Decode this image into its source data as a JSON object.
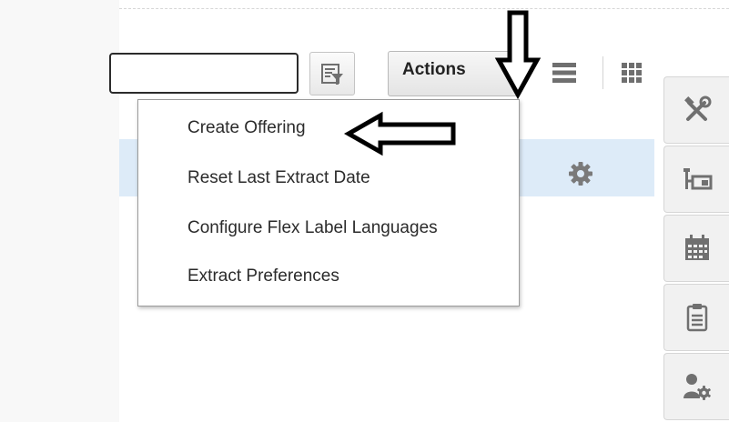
{
  "search": {
    "value": "",
    "placeholder": ""
  },
  "toolbar": {
    "filter_icon": "filter-list-icon",
    "actions_label": "Actions",
    "view_list_icon": "list-view-icon",
    "view_grid_icon": "grid-view-icon"
  },
  "actions_menu": {
    "items": [
      {
        "label": "Create Offering"
      },
      {
        "label": "Reset Last Extract Date"
      },
      {
        "label": "Configure Flex Label Languages"
      },
      {
        "label": "Extract Preferences"
      }
    ]
  },
  "table": {
    "selected_row_action_icon": "gear-icon"
  },
  "side_rail": {
    "items": [
      {
        "icon": "tools-icon"
      },
      {
        "icon": "hierarchy-icon"
      },
      {
        "icon": "calendar-icon"
      },
      {
        "icon": "clipboard-icon"
      },
      {
        "icon": "user-settings-icon"
      }
    ]
  },
  "colors": {
    "row_highlight": "#ddebf8",
    "icon_gray": "#6f6f6f"
  }
}
